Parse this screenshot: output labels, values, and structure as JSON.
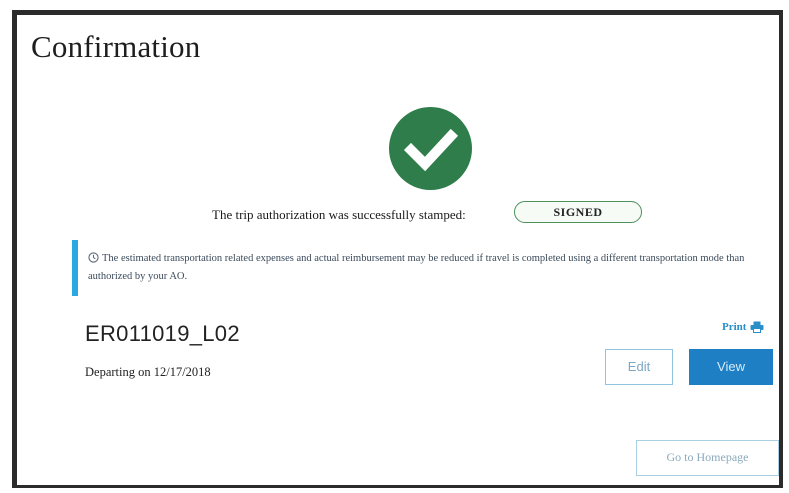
{
  "page": {
    "title": "Confirmation"
  },
  "status": {
    "message": "The trip authorization was successfully stamped:",
    "badge": "SIGNED",
    "success_color": "#2e7d4a"
  },
  "notice": {
    "icon": "clock-icon",
    "text": "The estimated transportation related expenses and actual reimbursement may be reduced if travel is completed using a different transportation mode than authorized by your AO."
  },
  "trip": {
    "id": "ER011019_L02",
    "departing": "Departing on 12/17/2018"
  },
  "actions": {
    "print_label": "Print",
    "print_icon": "printer-icon",
    "edit_label": "Edit",
    "view_label": "View",
    "home_label": "Go to Homepage",
    "accent_color": "#1f7fc4"
  }
}
